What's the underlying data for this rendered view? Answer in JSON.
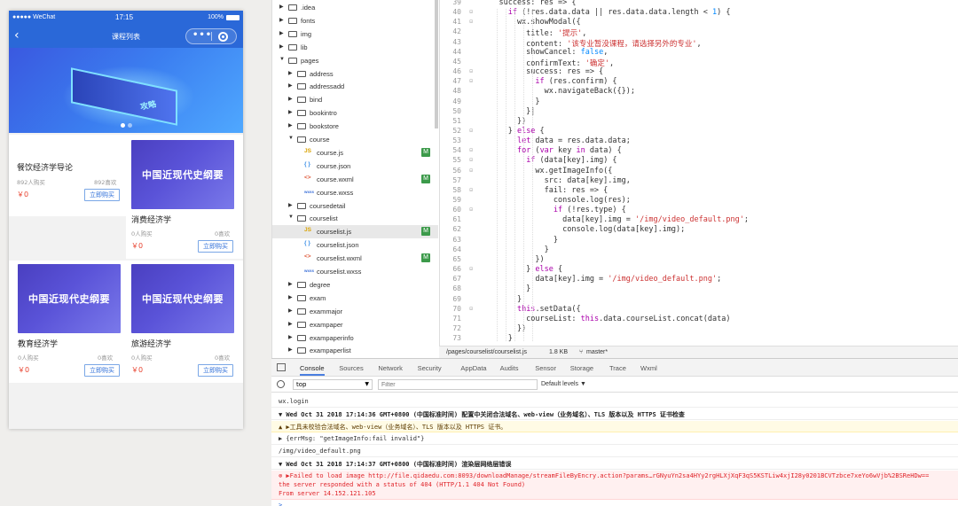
{
  "simulator": {
    "status": {
      "carrier": "●●●●● WeChat",
      "time": "17:15",
      "battery": "100%"
    },
    "nav": {
      "back_icon": "chevron-left-icon",
      "title": "课程列表",
      "more_icon": "more-dots-icon",
      "close_icon": "target-icon"
    },
    "courses": [
      {
        "name": "餐饮经济学导论",
        "buyers": "892人购买",
        "views": "892喜欢",
        "price": "￥0",
        "buy": "立即购买"
      },
      {
        "thumb_text": "中国近现代史纲要",
        "name": "消费经济学",
        "buyers": "0人购买",
        "views": "0喜欢",
        "price": "￥0",
        "buy": "立即购买"
      },
      {
        "thumb_text": "中国近现代史纲要",
        "name": "教育经济学",
        "buyers": "0人购买",
        "views": "0喜欢",
        "price": "￥0",
        "buy": "立即购买"
      },
      {
        "thumb_text": "中国近现代史纲要",
        "name": "旅游经济学",
        "buyers": "0人购买",
        "views": "0喜欢",
        "price": "￥0",
        "buy": "立即购买"
      }
    ],
    "banner_text": "攻略"
  },
  "tree": [
    {
      "label": ".idea",
      "kind": "folder",
      "open": false,
      "depth": 0
    },
    {
      "label": "fonts",
      "kind": "folder",
      "open": false,
      "depth": 0
    },
    {
      "label": "img",
      "kind": "folder",
      "open": false,
      "depth": 0
    },
    {
      "label": "lib",
      "kind": "folder",
      "open": false,
      "depth": 0
    },
    {
      "label": "pages",
      "kind": "folder",
      "open": true,
      "depth": 0
    },
    {
      "label": "address",
      "kind": "folder",
      "open": false,
      "depth": 1
    },
    {
      "label": "addressadd",
      "kind": "folder",
      "open": false,
      "depth": 1
    },
    {
      "label": "bind",
      "kind": "folder",
      "open": false,
      "depth": 1
    },
    {
      "label": "bookintro",
      "kind": "folder",
      "open": false,
      "depth": 1
    },
    {
      "label": "bookstore",
      "kind": "folder",
      "open": false,
      "depth": 1
    },
    {
      "label": "course",
      "kind": "folder",
      "open": true,
      "depth": 1
    },
    {
      "label": "course.js",
      "kind": "js",
      "depth": 2,
      "badge": "M"
    },
    {
      "label": "course.json",
      "kind": "json",
      "depth": 2
    },
    {
      "label": "course.wxml",
      "kind": "wxml",
      "depth": 2,
      "badge": "M"
    },
    {
      "label": "course.wxss",
      "kind": "wxss",
      "depth": 2
    },
    {
      "label": "coursedetail",
      "kind": "folder",
      "open": false,
      "depth": 1
    },
    {
      "label": "courselist",
      "kind": "folder",
      "open": true,
      "depth": 1
    },
    {
      "label": "courselist.js",
      "kind": "js",
      "depth": 2,
      "badge": "M",
      "selected": true
    },
    {
      "label": "courselist.json",
      "kind": "json",
      "depth": 2
    },
    {
      "label": "courselist.wxml",
      "kind": "wxml",
      "depth": 2,
      "badge": "M"
    },
    {
      "label": "courselist.wxss",
      "kind": "wxss",
      "depth": 2
    },
    {
      "label": "degree",
      "kind": "folder",
      "open": false,
      "depth": 1
    },
    {
      "label": "exam",
      "kind": "folder",
      "open": false,
      "depth": 1
    },
    {
      "label": "exammajor",
      "kind": "folder",
      "open": false,
      "depth": 1
    },
    {
      "label": "exampaper",
      "kind": "folder",
      "open": false,
      "depth": 1
    },
    {
      "label": "exampaperinfo",
      "kind": "folder",
      "open": false,
      "depth": 1
    },
    {
      "label": "exampaperlist",
      "kind": "folder",
      "open": false,
      "depth": 1
    }
  ],
  "editor": {
    "lines": [
      {
        "n": "39",
        "fold": "",
        "text": "    success: res => {"
      },
      {
        "n": "40",
        "fold": "⊟",
        "text": "      if (!res.data.data || res.data.data.length < 1) {"
      },
      {
        "n": "41",
        "fold": "⊟",
        "text": "        wx.showModal({"
      },
      {
        "n": "42",
        "fold": "",
        "text": "          title: '提示',"
      },
      {
        "n": "43",
        "fold": "",
        "text": "          content: '该专业暂没课程，请选择另外的专业',"
      },
      {
        "n": "44",
        "fold": "",
        "text": "          showCancel: false,"
      },
      {
        "n": "45",
        "fold": "",
        "text": "          confirmText: '确定',"
      },
      {
        "n": "46",
        "fold": "⊟",
        "text": "          success: res => {"
      },
      {
        "n": "47",
        "fold": "⊟",
        "text": "            if (res.confirm) {"
      },
      {
        "n": "48",
        "fold": "",
        "text": "              wx.navigateBack({});"
      },
      {
        "n": "49",
        "fold": "",
        "text": "            }"
      },
      {
        "n": "50",
        "fold": "",
        "text": "          }|"
      },
      {
        "n": "51",
        "fold": "",
        "text": "        })"
      },
      {
        "n": "52",
        "fold": "⊟",
        "text": "      } else {"
      },
      {
        "n": "53",
        "fold": "",
        "text": "        let data = res.data.data;"
      },
      {
        "n": "54",
        "fold": "⊟",
        "text": "        for (var key in data) {"
      },
      {
        "n": "55",
        "fold": "⊟",
        "text": "          if (data[key].img) {"
      },
      {
        "n": "56",
        "fold": "⊟",
        "text": "            wx.getImageInfo({"
      },
      {
        "n": "57",
        "fold": "",
        "text": "              src: data[key].img,"
      },
      {
        "n": "58",
        "fold": "⊟",
        "text": "              fail: res => {"
      },
      {
        "n": "59",
        "fold": "",
        "text": "                console.log(res);"
      },
      {
        "n": "60",
        "fold": "⊟",
        "text": "                if (!res.type) {"
      },
      {
        "n": "61",
        "fold": "",
        "text": "                  data[key].img = '/img/video_default.png';"
      },
      {
        "n": "62",
        "fold": "",
        "text": "                  console.log(data[key].img);"
      },
      {
        "n": "63",
        "fold": "",
        "text": "                }"
      },
      {
        "n": "64",
        "fold": "",
        "text": "              }"
      },
      {
        "n": "65",
        "fold": "",
        "text": "            })"
      },
      {
        "n": "66",
        "fold": "⊟",
        "text": "          } else {"
      },
      {
        "n": "67",
        "fold": "",
        "text": "            data[key].img = '/img/video_default.png';"
      },
      {
        "n": "68",
        "fold": "",
        "text": "          }"
      },
      {
        "n": "69",
        "fold": "",
        "text": "        }"
      },
      {
        "n": "70",
        "fold": "⊟",
        "text": "        this.setData({"
      },
      {
        "n": "71",
        "fold": "",
        "text": "          courseList: this.data.courseList.concat(data)"
      },
      {
        "n": "72",
        "fold": "",
        "text": "        })"
      },
      {
        "n": "73",
        "fold": "",
        "text": "      }"
      }
    ],
    "status": {
      "path": "/pages/courselist/courselist.js",
      "size": "1.8 KB",
      "branch": "master*"
    }
  },
  "devtools": {
    "tabs": [
      "Console",
      "Sources",
      "Network",
      "Security",
      "AppData",
      "Audits",
      "Sensor",
      "Storage",
      "Trace",
      "Wxml"
    ],
    "active_tab": "Console",
    "context": "top",
    "filter_placeholder": "Filter",
    "levels": "Default levels ▼",
    "logs": [
      {
        "type": "plain",
        "text": "wx.login"
      },
      {
        "type": "group",
        "text": "▼ Wed Oct 31 2018 17:14:36 GMT+0800 (中国标准时间) 配置中关闭合法域名、web-view（业务域名）、TLS 版本以及 HTTPS 证书检查"
      },
      {
        "type": "warn",
        "text": "▲ ▶工具未校验合法域名、web-view（业务域名）、TLS 版本以及 HTTPS 证书。"
      },
      {
        "type": "plain",
        "text": "  ▶ {errMsg: \"getImageInfo:fail invalid\"}"
      },
      {
        "type": "plain",
        "text": "  /img/video_default.png"
      },
      {
        "type": "group",
        "text": "▼ Wed Oct 31 2018 17:14:37 GMT+0800 (中国标准时间) 渲染层网络层错误"
      },
      {
        "type": "error",
        "text": "⊗ ▶Failed to load image http://file.qidaedu.com:8093/downloadManage/streamFileByEncry.action?params…rGNyuYn2sa4HYy2rgHLXjXqF3qS5KSTLiw4xjI28y0201BCVTzbce7xeYo6wVjb%2BSReHDw==\n   the server responded with a status of 404 (HTTP/1.1 404 Not Found)\n   From server 14.152.121.105"
      }
    ],
    "prompt": ">"
  }
}
